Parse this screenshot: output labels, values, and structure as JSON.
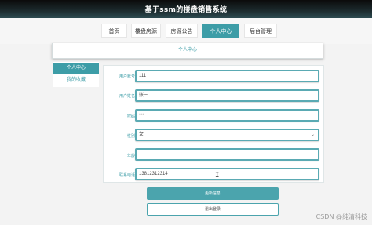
{
  "app": {
    "title": "基于ssm的楼盘销售系统"
  },
  "nav": {
    "items": [
      {
        "label": "首页",
        "active": false
      },
      {
        "label": "楼盘房源",
        "active": false
      },
      {
        "label": "房源公告",
        "active": false
      },
      {
        "label": "个人中心",
        "active": true
      },
      {
        "label": "后台管理",
        "active": false
      }
    ]
  },
  "card": {
    "title": "个人中心"
  },
  "sidebar": {
    "items": [
      {
        "label": "个人中心",
        "active": true
      },
      {
        "label": "我的收藏",
        "active": false
      }
    ]
  },
  "form": {
    "fields": [
      {
        "label": "用户账号",
        "value": "111",
        "type": "text"
      },
      {
        "label": "用户姓名",
        "value": "张三",
        "type": "text"
      },
      {
        "label": "密码",
        "value": "•••",
        "type": "password"
      },
      {
        "label": "性别",
        "value": "女",
        "type": "select"
      },
      {
        "label": "年龄",
        "value": "",
        "type": "text"
      },
      {
        "label": "联系电话",
        "value": "13812312314",
        "type": "text"
      }
    ],
    "submit_label": "更新信息",
    "logout_label": "退出登录"
  },
  "colors": {
    "accent": "#3d9da7",
    "topbar": "#1c2b2e"
  },
  "watermark": "CSDN @纯清科技"
}
